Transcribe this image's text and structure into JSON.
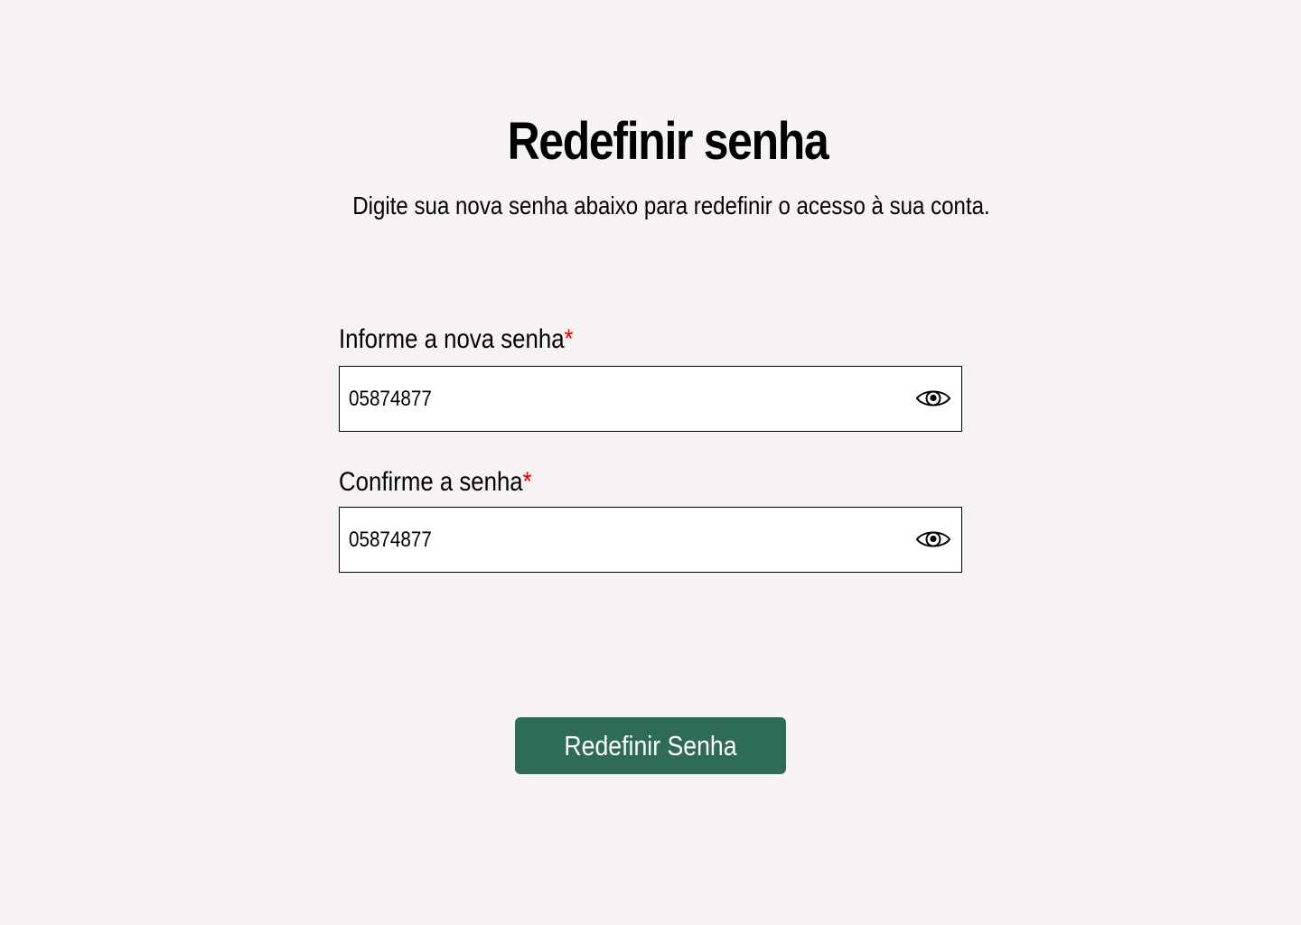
{
  "header": {
    "title": "Redefinir senha",
    "subtitle": "Digite sua nova senha abaixo para redefinir o acesso à sua conta."
  },
  "form": {
    "new_password": {
      "label": "Informe a nova senha",
      "required_mark": "*",
      "value": "05874877",
      "toggle_icon": "eye-icon"
    },
    "confirm_password": {
      "label": "Confirme a senha",
      "required_mark": "*",
      "value": "05874877",
      "toggle_icon": "eye-icon"
    },
    "submit_label": "Redefinir Senha"
  },
  "colors": {
    "background": "#f7f3f2",
    "button": "#2e6b58",
    "required": "#e50000"
  }
}
